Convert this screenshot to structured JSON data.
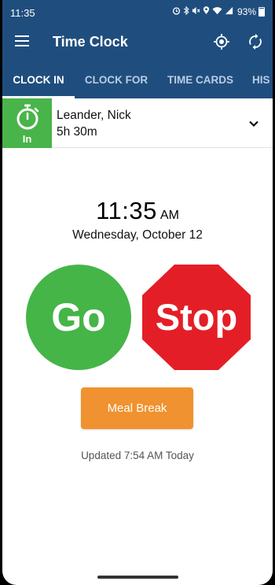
{
  "status_bar": {
    "time": "11:35",
    "battery": "93%",
    "icons": [
      "alarm-icon",
      "bluetooth-icon",
      "mute-icon",
      "location-icon",
      "wifi-icon",
      "signal-icon",
      "battery-icon"
    ]
  },
  "app_bar": {
    "title": "Time Clock",
    "icons": [
      "menu-icon",
      "location-target-icon",
      "sync-icon"
    ]
  },
  "tabs": [
    {
      "label": "CLOCK IN",
      "active": true
    },
    {
      "label": "CLOCK FOR",
      "active": false
    },
    {
      "label": "TIME CARDS",
      "active": false
    },
    {
      "label": "HIS",
      "active": false
    }
  ],
  "employee": {
    "status": "In",
    "name": "Leander, Nick",
    "hours": "5h 30m"
  },
  "clock": {
    "time": "11:35",
    "ampm": "AM",
    "date": "Wednesday, October 12"
  },
  "actions": {
    "go_label": "Go",
    "stop_label": "Stop",
    "meal_break_label": "Meal Break"
  },
  "updated_text": "Updated 7:54 AM Today",
  "colors": {
    "primary": "#1f4e7e",
    "go": "#45b548",
    "stop": "#e41e26",
    "meal_break": "#f0922f",
    "status_in": "#49b449"
  }
}
